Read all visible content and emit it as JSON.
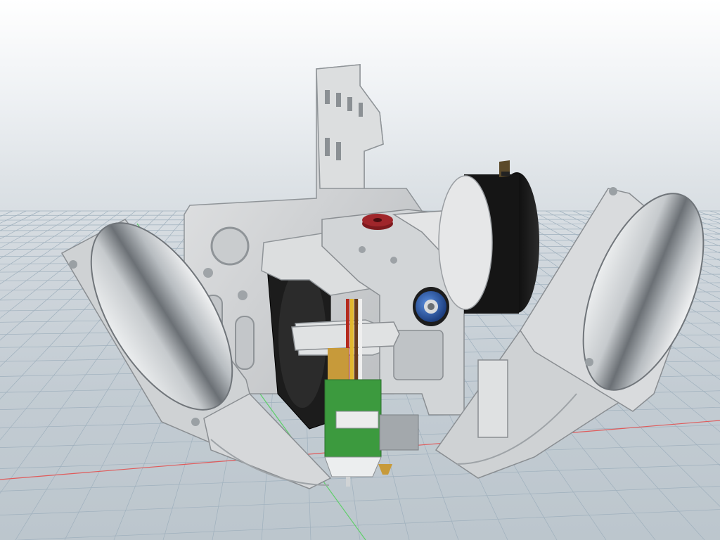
{
  "viewport": {
    "type": "cad-3d-viewport",
    "background_top_color": "#ffffff",
    "background_bottom_color": "#bcc6cd",
    "grid_color": "#9fb0bd",
    "x_axis_color": "#e05a5a",
    "y_axis_color": "#5fcf6a",
    "model": {
      "description_icons": [
        "mounting-plate-icon",
        "left-blower-fan-icon",
        "right-blower-fan-icon",
        "stepper-motor-icon",
        "axial-fan-icon",
        "hotend-icon",
        "filament-gear-icon",
        "bearing-icon"
      ],
      "colors": {
        "plastic_gray": "#d7d9db",
        "plastic_shadow": "#9da2a6",
        "motor_black": "#161616",
        "bearing_blue": "#2f5fb3",
        "gear_red": "#a0262b",
        "pcb_green": "#3c9a3e",
        "brass": "#c79a3a"
      }
    }
  }
}
